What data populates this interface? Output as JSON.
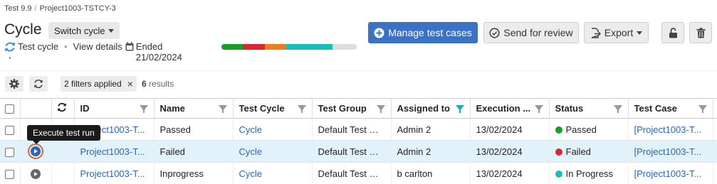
{
  "breadcrumb": [
    "Test 9.9",
    "Project1003-TSTCY-3"
  ],
  "page_title": "Cycle",
  "switch_cycle_label": "Switch cycle",
  "meta": {
    "type_label": "Test cycle",
    "view_details_label": "View details",
    "ended_label": "Ended",
    "ended_date": "21/02/2024"
  },
  "progress": [
    {
      "status": "passed",
      "color": "#1a9c2c",
      "fraction": 0.16
    },
    {
      "status": "failed",
      "color": "#d92637",
      "fraction": 0.16
    },
    {
      "status": "other",
      "color": "#f07d1c",
      "fraction": 0.16
    },
    {
      "status": "in-progress",
      "color": "#19bfb7",
      "fraction": 0.34
    },
    {
      "status": "remaining",
      "color": "#dddddd",
      "fraction": 0.18
    }
  ],
  "actions": {
    "manage_label": "Manage test cases",
    "review_label": "Send for review",
    "export_label": "Export"
  },
  "filters": {
    "chip_label": "2 filters applied",
    "results_count": "6",
    "results_label": "results"
  },
  "columns": [
    "ID",
    "Name",
    "Test Cycle",
    "Test Group",
    "Assigned to",
    "Execution ...",
    "Status",
    "Test Case"
  ],
  "rows": [
    {
      "id": "Project1003-T...",
      "name": "Passed",
      "cycle": "Cycle",
      "group": "Default Test Gr...",
      "assigned": "Admin 2",
      "date": "13/02/2024",
      "status": "Passed",
      "status_color": "#1a9c2c",
      "test_case": "[Project1003-T..."
    },
    {
      "id": "Project1003-T...",
      "name": "Failed",
      "cycle": "Cycle",
      "group": "Default Test Gr...",
      "assigned": "Admin 2",
      "date": "13/02/2024",
      "status": "Failed",
      "status_color": "#d92637",
      "test_case": "[Project1003-T..."
    },
    {
      "id": "Project1003-T...",
      "name": "Inprogress",
      "cycle": "Cycle",
      "group": "Default Test Gr...",
      "assigned": "b carlton",
      "date": "13/02/2024",
      "status": "In Progress",
      "status_color": "#19bfb7",
      "test_case": "[Project1003-T..."
    }
  ],
  "tooltip": "Execute test run",
  "colors": {
    "primary": "#3a72c6",
    "link": "#2a66b8",
    "highlight_row": "#e2f2fb"
  }
}
